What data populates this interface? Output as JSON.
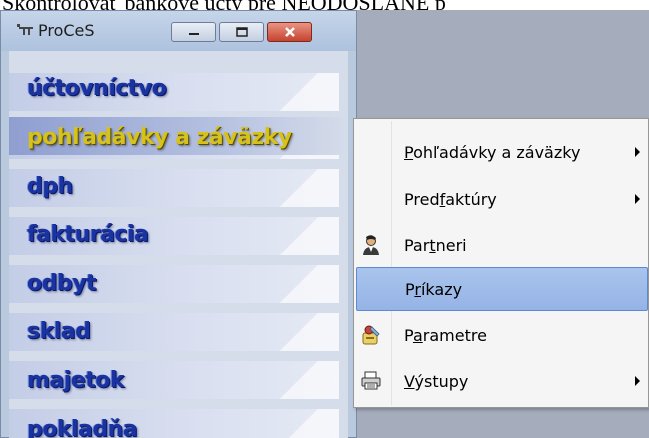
{
  "document": {
    "text": "Skontrolovať bankové účty pre NEODOSLANÉ p"
  },
  "window": {
    "title": "ProCeS",
    "controls": {
      "minimize": "minimize-icon",
      "maximize": "maximize-icon",
      "close": "close-icon"
    }
  },
  "main_menu": {
    "items": [
      {
        "label": "účtovníctvo"
      },
      {
        "label": "pohľadávky a záväzky",
        "active": true
      },
      {
        "label": "dph"
      },
      {
        "label": "fakturácia"
      },
      {
        "label": "odbyt"
      },
      {
        "label": "sklad"
      },
      {
        "label": "majetok"
      },
      {
        "label": "pokladňa"
      }
    ]
  },
  "context_menu": {
    "items": [
      {
        "label": "Pohľadávky a záväzky",
        "accel": "P",
        "submenu": true,
        "icon": ""
      },
      {
        "label": "Predfaktúry",
        "accel": "f",
        "submenu": true,
        "icon": ""
      },
      {
        "label": "Partneri",
        "accel": "t",
        "submenu": false,
        "icon": "person-icon"
      },
      {
        "label": "Príkazy",
        "accel": "r",
        "submenu": false,
        "icon": "",
        "highlighted": true
      },
      {
        "label": "Parametre",
        "accel": "a",
        "submenu": false,
        "icon": "settings-icon"
      },
      {
        "label": "Výstupy",
        "accel": "V",
        "submenu": true,
        "icon": "printer-icon"
      }
    ]
  },
  "colors": {
    "menu_text": "#1a33a3",
    "active_text": "#d6c21b",
    "highlight": "#a9c4ec"
  }
}
